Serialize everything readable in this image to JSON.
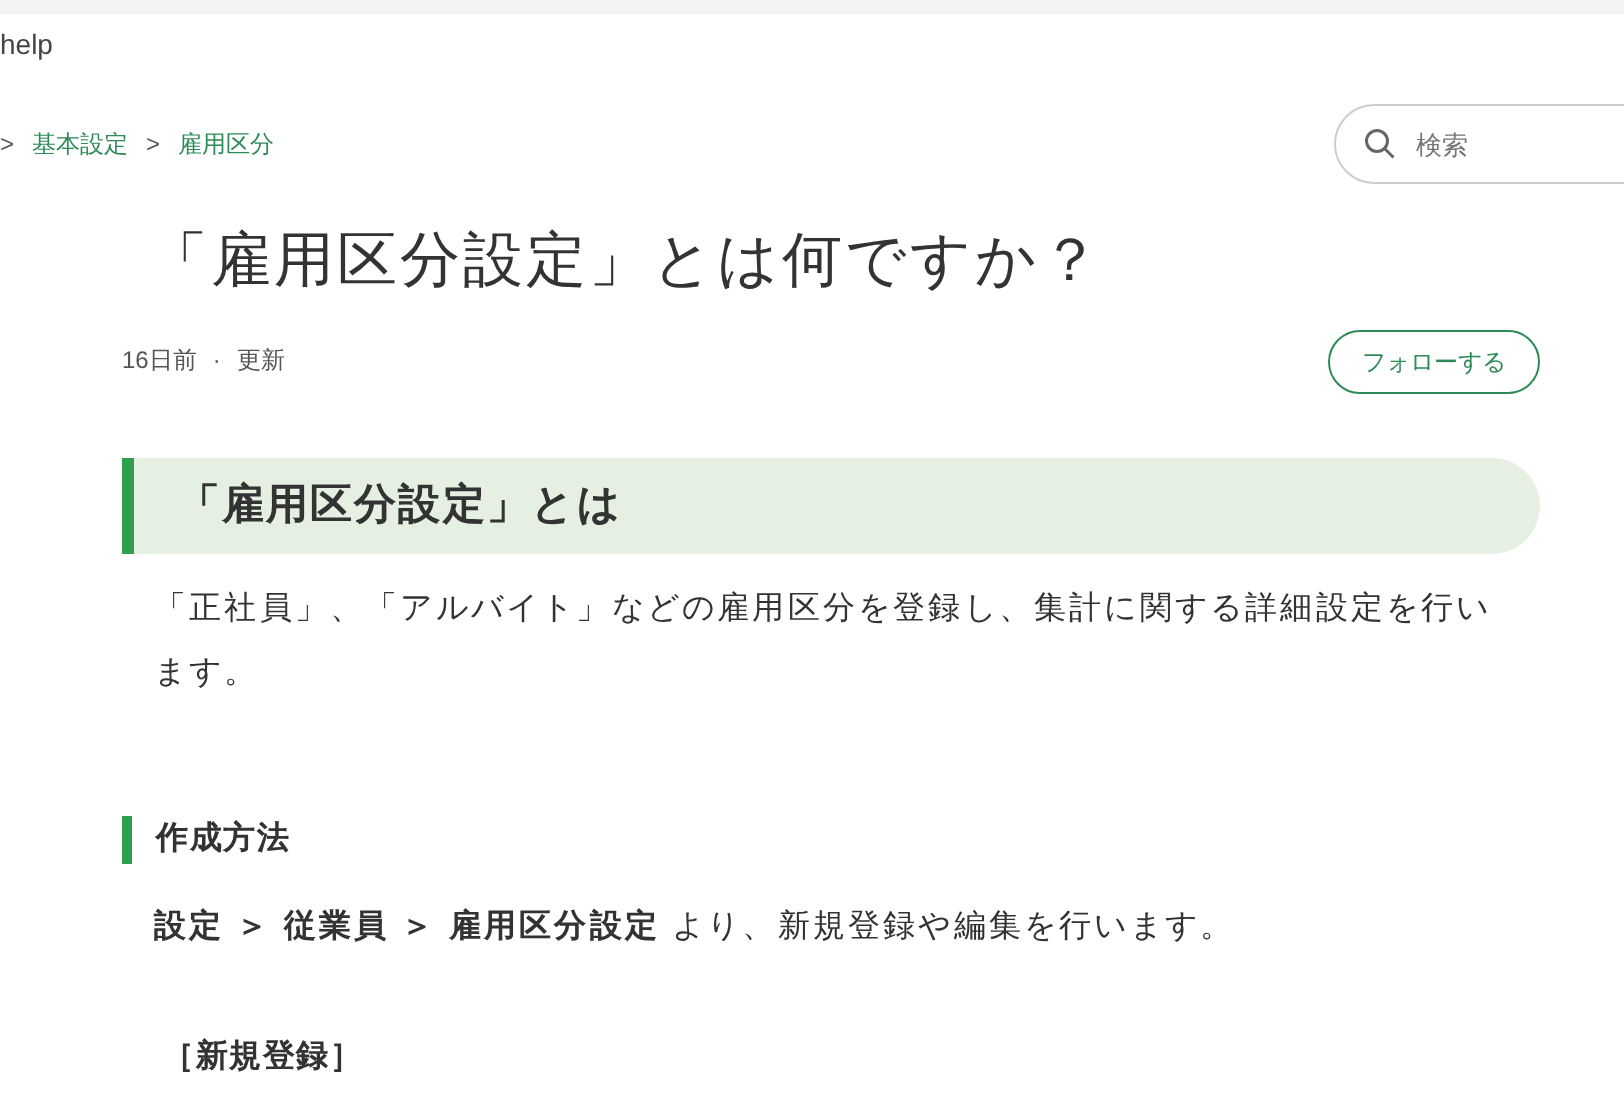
{
  "header": {
    "brand": "help"
  },
  "breadcrumb": {
    "separator": ">",
    "items": [
      {
        "label": "基本設定"
      },
      {
        "label": "雇用区分"
      }
    ]
  },
  "search": {
    "placeholder": "検索"
  },
  "article": {
    "title": "「雇用区分設定」とは何ですか？",
    "date": "16日前",
    "dot": "·",
    "updated": "更新",
    "follow_button": "フォローする"
  },
  "sections": [
    {
      "kind": "h2",
      "text": "「雇用区分設定」とは"
    },
    {
      "kind": "paragraph",
      "text": "「正社員」、「アルバイト」などの雇用区分を登録し、集計に関する詳細設定を行います。"
    },
    {
      "kind": "h3",
      "text": "作成方法"
    },
    {
      "kind": "paragraph",
      "text": "**設定 ＞ 従業員 ＞ 雇用区分設定** より、新規登録や編集を行います。"
    },
    {
      "kind": "label",
      "text": "［新規登録］"
    }
  ]
}
